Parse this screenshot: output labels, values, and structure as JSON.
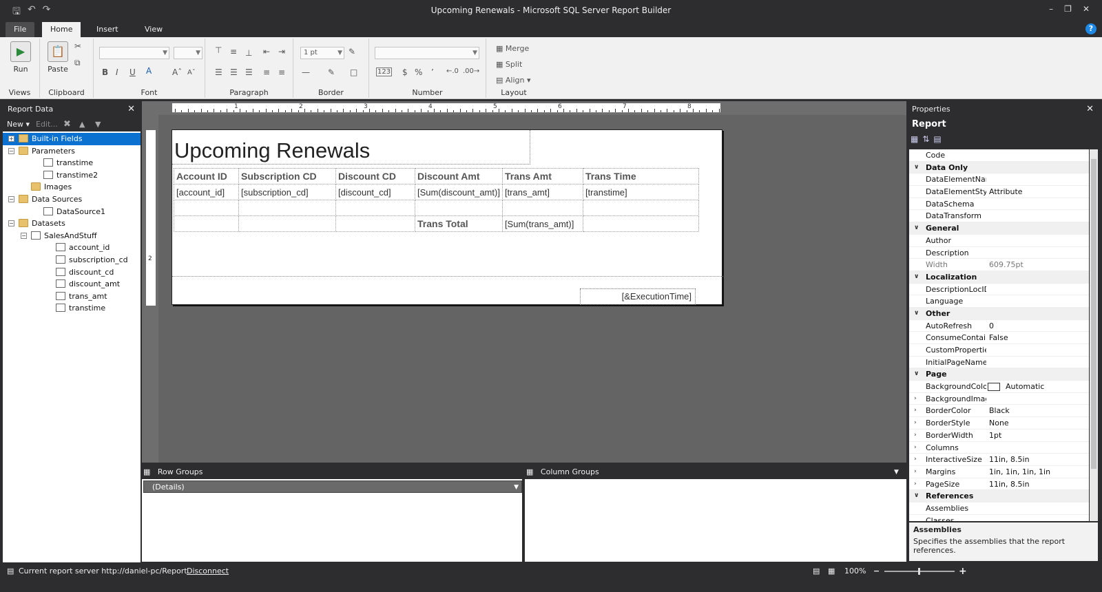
{
  "window": {
    "title": "Upcoming Renewals - Microsoft SQL Server Report Builder"
  },
  "tabs": {
    "file": "File",
    "home": "Home",
    "insert": "Insert",
    "view": "View"
  },
  "ribbon": {
    "views": {
      "run": "Run",
      "label": "Views"
    },
    "clipboard": {
      "paste": "Paste",
      "label": "Clipboard"
    },
    "font": {
      "label": "Font"
    },
    "paragraph": {
      "label": "Paragraph"
    },
    "border": {
      "width": "1 pt",
      "label": "Border"
    },
    "number": {
      "label": "Number",
      "placeholder": "123"
    },
    "layout": {
      "merge": "Merge",
      "split": "Split",
      "align": "Align",
      "label": "Layout"
    }
  },
  "report_data": {
    "title": "Report Data",
    "new": "New",
    "edit": "Edit...",
    "tree": [
      {
        "label": "Built-in Fields",
        "indent": 0,
        "exp": "+",
        "icon": "folder",
        "selected": true
      },
      {
        "label": "Parameters",
        "indent": 0,
        "exp": "-",
        "icon": "folder"
      },
      {
        "label": "transtime",
        "indent": 2,
        "icon": "param"
      },
      {
        "label": "transtime2",
        "indent": 2,
        "icon": "param"
      },
      {
        "label": "Images",
        "indent": 1,
        "icon": "folder"
      },
      {
        "label": "Data Sources",
        "indent": 0,
        "exp": "-",
        "icon": "folder"
      },
      {
        "label": "DataSource1",
        "indent": 2,
        "icon": "datasource"
      },
      {
        "label": "Datasets",
        "indent": 0,
        "exp": "-",
        "icon": "folder"
      },
      {
        "label": "SalesAndStuff",
        "indent": 1,
        "exp": "-",
        "icon": "dataset"
      },
      {
        "label": "account_id",
        "indent": 3,
        "icon": "field"
      },
      {
        "label": "subscription_cd",
        "indent": 3,
        "icon": "field"
      },
      {
        "label": "discount_cd",
        "indent": 3,
        "icon": "field"
      },
      {
        "label": "discount_amt",
        "indent": 3,
        "icon": "field"
      },
      {
        "label": "trans_amt",
        "indent": 3,
        "icon": "field"
      },
      {
        "label": "transtime",
        "indent": 3,
        "icon": "field"
      }
    ]
  },
  "report": {
    "title": "Upcoming Renewals",
    "headers": [
      "Account ID",
      "Subscription CD",
      "Discount CD",
      "Discount Amt",
      "Trans Amt",
      "Trans Time"
    ],
    "detail": [
      "[account_id]",
      "[subscription_cd]",
      "[discount_cd]",
      "[Sum(discount_amt)]",
      "[trans_amt]",
      "[transtime]"
    ],
    "total_label": "Trans Total",
    "total_value": "[Sum(trans_amt)]",
    "execution_time": "[&ExecutionTime]",
    "ruler": [
      "1",
      "2",
      "3",
      "4",
      "5",
      "6",
      "7",
      "8"
    ],
    "vruler": "2"
  },
  "groups": {
    "row_title": "Row Groups",
    "column_title": "Column Groups",
    "details": "(Details)"
  },
  "properties": {
    "title": "Properties",
    "object": "Report",
    "rows": [
      {
        "name": "Code",
        "value": ""
      },
      {
        "cat": "Data Only"
      },
      {
        "name": "DataElementName",
        "value": ""
      },
      {
        "name": "DataElementStyle",
        "value": "Attribute"
      },
      {
        "name": "DataSchema",
        "value": ""
      },
      {
        "name": "DataTransform",
        "value": ""
      },
      {
        "cat": "General"
      },
      {
        "name": "Author",
        "value": ""
      },
      {
        "name": "Description",
        "value": ""
      },
      {
        "name": "Width",
        "value": "609.75pt",
        "dim": true,
        "dimname": true
      },
      {
        "cat": "Localization"
      },
      {
        "name": "DescriptionLocID",
        "value": ""
      },
      {
        "name": "Language",
        "value": ""
      },
      {
        "cat": "Other"
      },
      {
        "name": "AutoRefresh",
        "value": "0"
      },
      {
        "name": "ConsumeContainerWhitespace",
        "value": "False"
      },
      {
        "name": "CustomProperties",
        "value": ""
      },
      {
        "name": "InitialPageName",
        "value": ""
      },
      {
        "cat": "Page"
      },
      {
        "name": "BackgroundColor",
        "value": "Automatic",
        "swatch": true
      },
      {
        "name": "BackgroundImage",
        "value": "",
        "expand": true
      },
      {
        "name": "BorderColor",
        "value": "Black",
        "expand": true
      },
      {
        "name": "BorderStyle",
        "value": "None",
        "expand": true
      },
      {
        "name": "BorderWidth",
        "value": "1pt",
        "expand": true
      },
      {
        "name": "Columns",
        "value": "",
        "expand": true
      },
      {
        "name": "InteractiveSize",
        "value": "11in, 8.5in",
        "expand": true
      },
      {
        "name": "Margins",
        "value": "1in, 1in, 1in, 1in",
        "expand": true
      },
      {
        "name": "PageSize",
        "value": "11in, 8.5in",
        "expand": true
      },
      {
        "cat": "References"
      },
      {
        "name": "Assemblies",
        "value": ""
      },
      {
        "name": "Classes",
        "value": ""
      }
    ],
    "desc_title": "Assemblies",
    "desc_text": "Specifies the assemblies that the report references."
  },
  "status": {
    "server": "Current report server http://daniel-pc/Report",
    "disconnect": "Disconnect",
    "zoom": "100%"
  }
}
